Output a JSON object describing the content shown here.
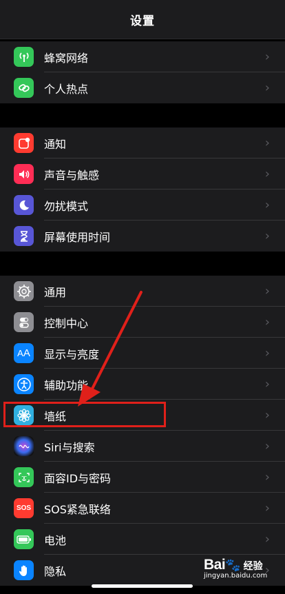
{
  "header": {
    "title": "设置"
  },
  "groups": [
    {
      "items": [
        {
          "label": "蜂窝网络",
          "icon": "cellular-antenna-icon",
          "color": "#34c759"
        },
        {
          "label": "个人热点",
          "icon": "hotspot-chain-icon",
          "color": "#34c759"
        }
      ]
    },
    {
      "items": [
        {
          "label": "通知",
          "icon": "notification-icon",
          "color": "#ff3b30"
        },
        {
          "label": "声音与触感",
          "icon": "speaker-icon",
          "color": "#ff2d55"
        },
        {
          "label": "勿扰模式",
          "icon": "moon-icon",
          "color": "#5856d6"
        },
        {
          "label": "屏幕使用时间",
          "icon": "hourglass-icon",
          "color": "#5856d6"
        }
      ]
    },
    {
      "items": [
        {
          "label": "通用",
          "icon": "gear-icon",
          "color": "#8e8e93"
        },
        {
          "label": "控制中心",
          "icon": "toggle-switch-icon",
          "color": "#8e8e93"
        },
        {
          "label": "显示与亮度",
          "icon": "text-size-icon",
          "color": "#0a84ff"
        },
        {
          "label": "辅助功能",
          "icon": "accessibility-icon",
          "color": "#0a84ff"
        },
        {
          "label": "墙纸",
          "icon": "flower-icon",
          "color": "#30b0e0"
        },
        {
          "label": "Siri与搜索",
          "icon": "siri-icon",
          "color": "#222222"
        },
        {
          "label": "面容ID与密码",
          "icon": "face-id-icon",
          "color": "#34c759"
        },
        {
          "label": "SOS紧急联络",
          "icon": "sos-icon",
          "color": "#ff3b30"
        },
        {
          "label": "电池",
          "icon": "battery-icon",
          "color": "#34c759"
        },
        {
          "label": "隐私",
          "icon": "hand-icon",
          "color": "#0a84ff"
        }
      ]
    }
  ],
  "chevron": "›",
  "annotation": {
    "highlight_color": "#e0201a",
    "highlighted_item": "墙纸"
  },
  "watermark": {
    "logo": "Bai",
    "logo_suffix": "经验",
    "url": "jingyan.baidu.com"
  }
}
